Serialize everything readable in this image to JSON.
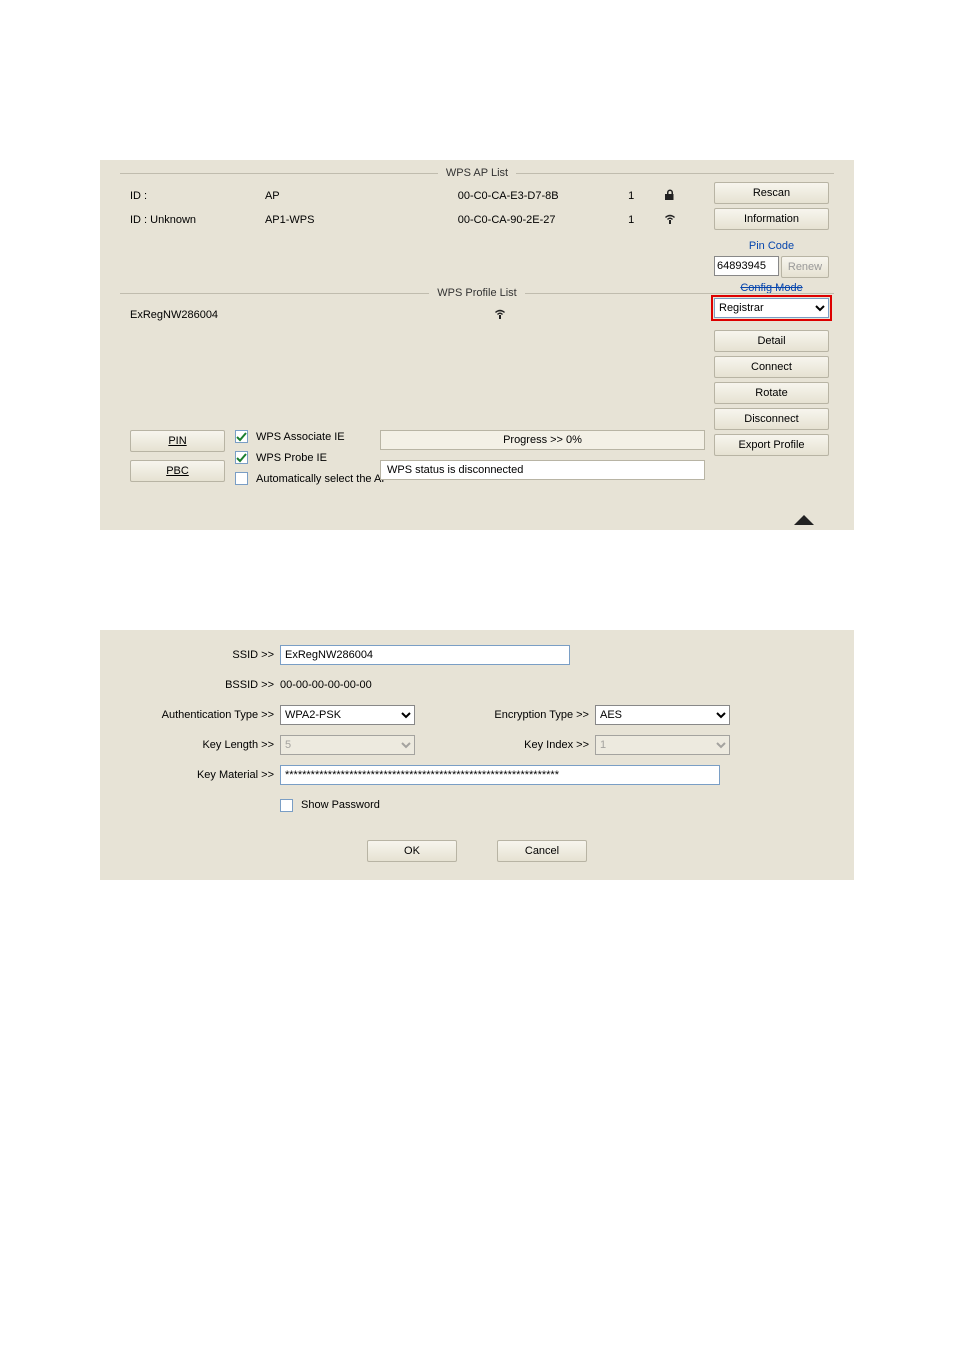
{
  "headers": {
    "wps_ap_list": "WPS AP List",
    "wps_profile_list": "WPS Profile List"
  },
  "ap_rows": [
    {
      "id": "ID :",
      "name": "AP",
      "mac": "00-C0-CA-E3-D7-8B",
      "channel": "1",
      "icon": "lock"
    },
    {
      "id": "ID : Unknown",
      "name": "AP1-WPS",
      "mac": "00-C0-CA-90-2E-27",
      "channel": "1",
      "icon": "signal"
    }
  ],
  "side": {
    "rescan": "Rescan",
    "information": "Information",
    "pin_code_label": "Pin Code",
    "pin_code_value": "64893945",
    "renew": "Renew",
    "config_mode_label": "Config Mode",
    "config_mode_value": "Registrar",
    "detail": "Detail",
    "connect": "Connect",
    "rotate": "Rotate",
    "disconnect": "Disconnect",
    "export_profile": "Export Profile"
  },
  "profile_rows": [
    {
      "name": "ExRegNW286004",
      "icon": "signal"
    }
  ],
  "bottom": {
    "pin": "PIN",
    "pbc": "PBC",
    "wps_associate_ie": "WPS Associate IE",
    "wps_probe_ie": "WPS Probe IE",
    "auto_select": "Automatically select the AP",
    "progress": "Progress >> 0%",
    "status": "WPS status is disconnected"
  },
  "form": {
    "ssid_label": "SSID >>",
    "ssid_value": "ExRegNW286004",
    "bssid_label": "BSSID >>",
    "bssid_value": "00-00-00-00-00-00",
    "auth_label": "Authentication Type >>",
    "auth_value": "WPA2-PSK",
    "enc_label": "Encryption Type >>",
    "enc_value": "AES",
    "klen_label": "Key Length >>",
    "klen_value": "5",
    "kidx_label": "Key Index >>",
    "kidx_value": "1",
    "kmat_label": "Key Material >>",
    "kmat_value": "****************************************************************",
    "show_pw": "Show Password",
    "ok": "OK",
    "cancel": "Cancel"
  }
}
